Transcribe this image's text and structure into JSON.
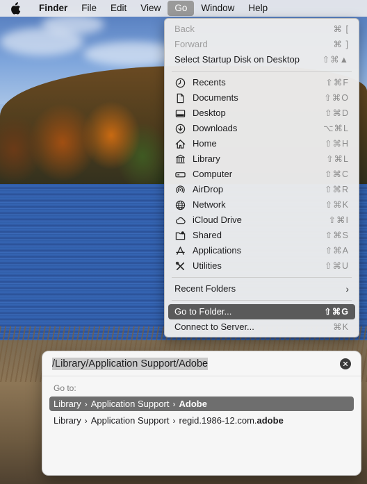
{
  "menubar": {
    "app_name": "Finder",
    "items": [
      "File",
      "Edit",
      "View",
      "Go",
      "Window",
      "Help"
    ],
    "active_item": "Go"
  },
  "go_menu": {
    "top_items": [
      {
        "label": "Back",
        "shortcut": "⌘ [",
        "disabled": true
      },
      {
        "label": "Forward",
        "shortcut": "⌘ ]",
        "disabled": true
      },
      {
        "label": "Select Startup Disk on Desktop",
        "shortcut": "⇧⌘▲",
        "disabled": false
      }
    ],
    "places": [
      {
        "label": "Recents",
        "shortcut": "⇧⌘F",
        "icon": "clock-icon"
      },
      {
        "label": "Documents",
        "shortcut": "⇧⌘O",
        "icon": "document-icon"
      },
      {
        "label": "Desktop",
        "shortcut": "⇧⌘D",
        "icon": "desktop-icon"
      },
      {
        "label": "Downloads",
        "shortcut": "⌥⌘L",
        "icon": "download-icon"
      },
      {
        "label": "Home",
        "shortcut": "⇧⌘H",
        "icon": "home-icon"
      },
      {
        "label": "Library",
        "shortcut": "⇧⌘L",
        "icon": "library-icon"
      },
      {
        "label": "Computer",
        "shortcut": "⇧⌘C",
        "icon": "computer-icon"
      },
      {
        "label": "AirDrop",
        "shortcut": "⇧⌘R",
        "icon": "airdrop-icon"
      },
      {
        "label": "Network",
        "shortcut": "⇧⌘K",
        "icon": "globe-icon"
      },
      {
        "label": "iCloud Drive",
        "shortcut": "⇧⌘I",
        "icon": "cloud-icon"
      },
      {
        "label": "Shared",
        "shortcut": "⇧⌘S",
        "icon": "shared-folder-icon"
      },
      {
        "label": "Applications",
        "shortcut": "⇧⌘A",
        "icon": "applications-icon"
      },
      {
        "label": "Utilities",
        "shortcut": "⇧⌘U",
        "icon": "utilities-icon"
      }
    ],
    "recent_folders": "Recent Folders",
    "go_to_folder": {
      "label": "Go to Folder...",
      "shortcut": "⇧⌘G"
    },
    "connect_to_server": {
      "label": "Connect to Server...",
      "shortcut": "⌘K"
    }
  },
  "goto_panel": {
    "path": "/Library/Application Support/Adobe",
    "goto_label": "Go to:",
    "results": [
      {
        "parts": [
          "Library",
          "Application Support"
        ],
        "last_plain": "",
        "last_bold": "Adobe",
        "selected": true
      },
      {
        "parts": [
          "Library",
          "Application Support"
        ],
        "last_plain": "regid.1986-12.com.",
        "last_bold": "adobe",
        "selected": false
      }
    ]
  }
}
